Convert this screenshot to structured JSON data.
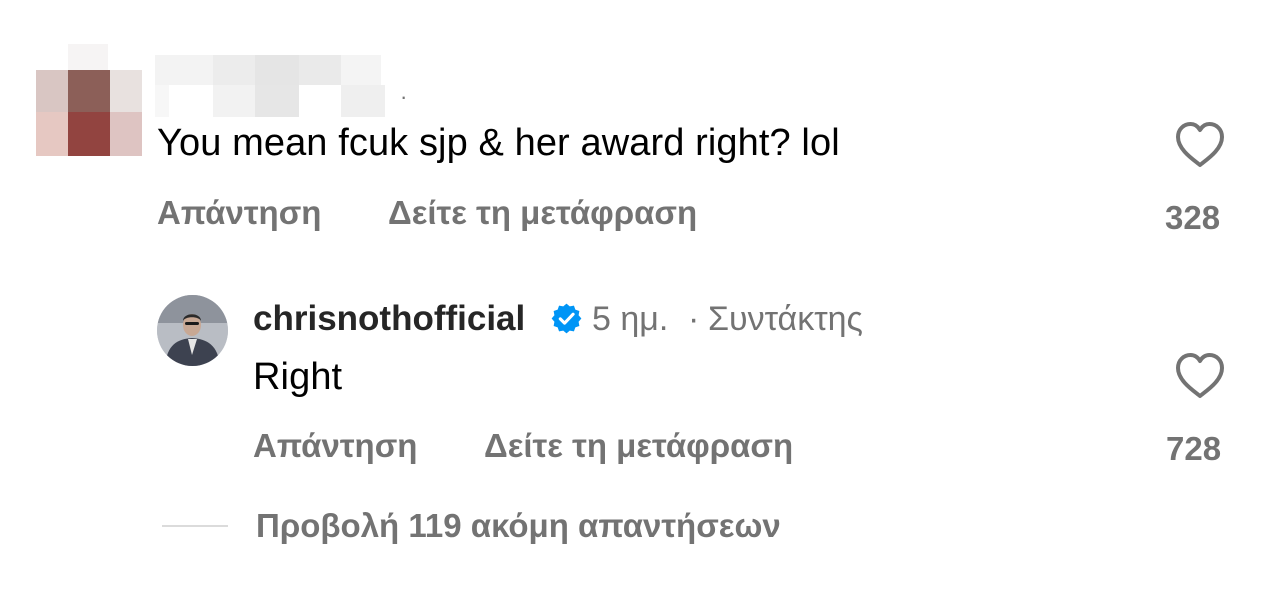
{
  "comment": {
    "text": "You mean fcuk sjp & her award right? lol",
    "reply_label": "Απάντηση",
    "translate_label": "Δείτε τη μετάφραση",
    "likes": "328",
    "name_separator": "·"
  },
  "reply": {
    "username": "chrisnothofficial",
    "time": "5 ημ.",
    "separator": "·",
    "role": "Συντάκτης",
    "text": "Right",
    "reply_label": "Απάντηση",
    "translate_label": "Δείτε τη μετάφραση",
    "likes": "728"
  },
  "more_replies": {
    "label": "Προβολή 119 ακόμη απαντήσεων"
  },
  "colors": {
    "muted_text": "#737373",
    "verified_blue": "#0095f6",
    "divider": "#dbdbdb"
  },
  "icons": [
    "heart-icon",
    "verified-badge-icon"
  ]
}
